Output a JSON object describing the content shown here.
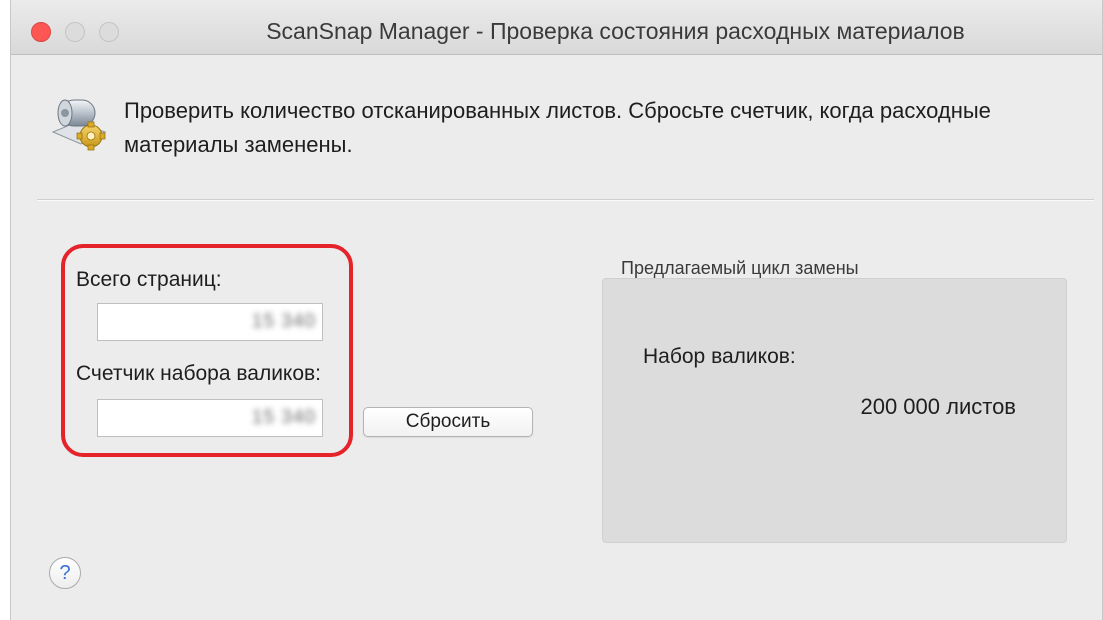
{
  "window": {
    "title": "ScanSnap Manager - Проверка состояния расходных материалов"
  },
  "header": {
    "icon": "scanner-gear-icon",
    "text": "Проверить количество отсканированных листов. Сбросьте счетчик, когда расходные материалы заменены."
  },
  "counters": {
    "total_pages_label": "Всего страниц:",
    "total_pages_value": "15 340",
    "roller_counter_label": "Счетчик набора валиков:",
    "roller_counter_value": "15 340",
    "reset_label": "Сбросить"
  },
  "replacement_cycle": {
    "title": "Предлагаемый цикл замены",
    "item_label": "Набор валиков:",
    "item_value": "200 000 листов"
  },
  "help": {
    "label": "?"
  },
  "colors": {
    "highlight": "#e4232b",
    "close_button": "#fc5753",
    "help_glyph": "#3a6fd8"
  }
}
